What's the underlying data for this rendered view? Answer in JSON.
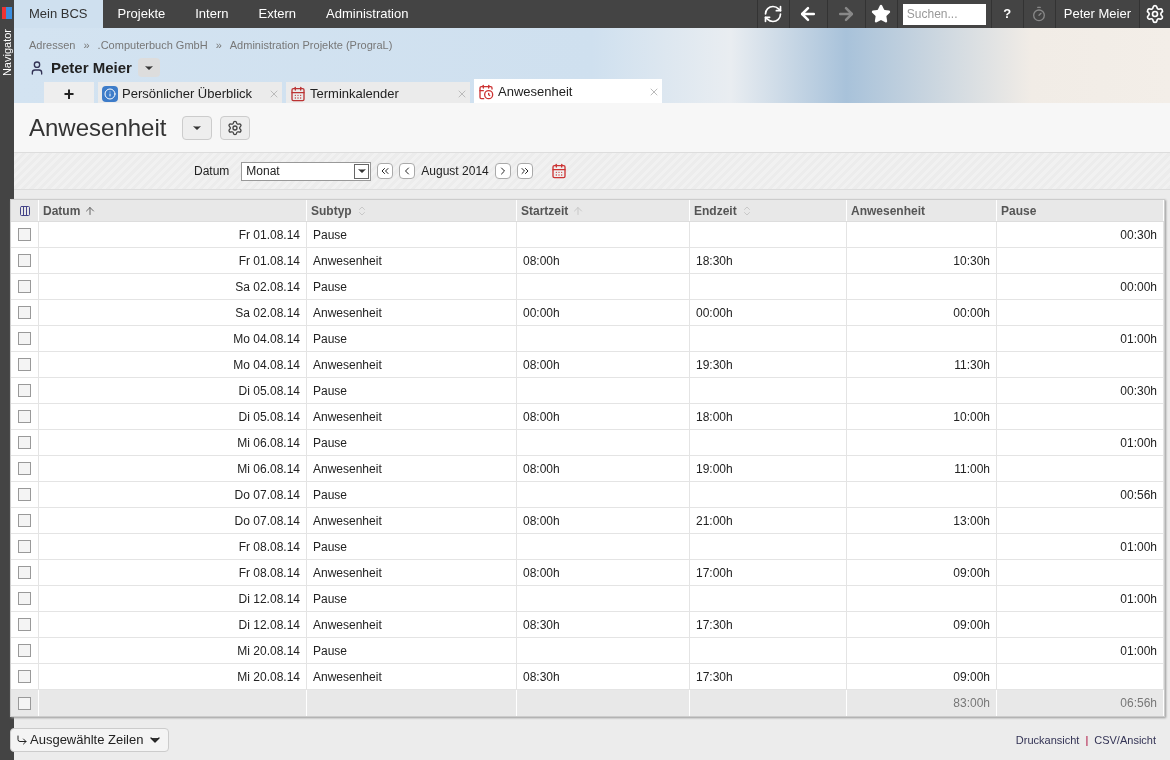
{
  "navigator": {
    "label": "Navigator"
  },
  "top_menu": [
    {
      "label": "Mein BCS",
      "selected": true
    },
    {
      "label": "Projekte",
      "selected": false
    },
    {
      "label": "Intern",
      "selected": false
    },
    {
      "label": "Extern",
      "selected": false
    },
    {
      "label": "Administration",
      "selected": false
    }
  ],
  "toolbar": {
    "search": {
      "placeholder": "Suchen..."
    },
    "help": "?",
    "user": "Peter Meier",
    "forward_disabled": true
  },
  "breadcrumb": [
    "Adressen",
    "»",
    ".Computerbuch GmbH",
    "»",
    "Administration Projekte (PrograL)"
  ],
  "person": "Peter Meier",
  "add_tab": "+",
  "tabs": [
    {
      "label": "Persönlicher Überblick",
      "kind": "info",
      "selected": false
    },
    {
      "label": "Terminkalender",
      "kind": "calendar",
      "selected": false
    },
    {
      "label": "Anwesenheit",
      "kind": "clock",
      "selected": true
    }
  ],
  "page_title": "Anwesenheit",
  "filter": {
    "label": "Datum",
    "value": "Monat",
    "period": "August 2014"
  },
  "table": {
    "columns": [
      {
        "label": "Datum",
        "kind": "sorted"
      },
      {
        "label": "Subtyp",
        "kind": "sortable"
      },
      {
        "label": "Startzeit",
        "kind": "presorted"
      },
      {
        "label": "Endzeit",
        "kind": "sortable"
      },
      {
        "label": "Anwesenheit",
        "kind": "plain"
      },
      {
        "label": "Pause",
        "kind": "plain"
      }
    ],
    "rows": [
      {
        "checked": false,
        "cells": [
          "Fr 01.08.14",
          "Pause",
          "",
          "",
          "",
          "00:30h"
        ]
      },
      {
        "checked": false,
        "cells": [
          "Fr 01.08.14",
          "Anwesenheit",
          "08:00h",
          "18:30h",
          "10:30h",
          ""
        ]
      },
      {
        "checked": false,
        "cells": [
          "Sa 02.08.14",
          "Pause",
          "",
          "",
          "",
          "00:00h"
        ]
      },
      {
        "checked": false,
        "cells": [
          "Sa 02.08.14",
          "Anwesenheit",
          "00:00h",
          "00:00h",
          "00:00h",
          ""
        ]
      },
      {
        "checked": false,
        "cells": [
          "Mo 04.08.14",
          "Pause",
          "",
          "",
          "",
          "01:00h"
        ]
      },
      {
        "checked": false,
        "cells": [
          "Mo 04.08.14",
          "Anwesenheit",
          "08:00h",
          "19:30h",
          "11:30h",
          ""
        ]
      },
      {
        "checked": false,
        "cells": [
          "Di 05.08.14",
          "Pause",
          "",
          "",
          "",
          "00:30h"
        ]
      },
      {
        "checked": false,
        "cells": [
          "Di 05.08.14",
          "Anwesenheit",
          "08:00h",
          "18:00h",
          "10:00h",
          ""
        ]
      },
      {
        "checked": false,
        "cells": [
          "Mi 06.08.14",
          "Pause",
          "",
          "",
          "",
          "01:00h"
        ]
      },
      {
        "checked": false,
        "cells": [
          "Mi 06.08.14",
          "Anwesenheit",
          "08:00h",
          "19:00h",
          "11:00h",
          ""
        ]
      },
      {
        "checked": false,
        "cells": [
          "Do 07.08.14",
          "Pause",
          "",
          "",
          "",
          "00:56h"
        ]
      },
      {
        "checked": false,
        "cells": [
          "Do 07.08.14",
          "Anwesenheit",
          "08:00h",
          "21:00h",
          "13:00h",
          ""
        ]
      },
      {
        "checked": false,
        "cells": [
          "Fr 08.08.14",
          "Pause",
          "",
          "",
          "",
          "01:00h"
        ]
      },
      {
        "checked": false,
        "cells": [
          "Fr 08.08.14",
          "Anwesenheit",
          "08:00h",
          "17:00h",
          "09:00h",
          ""
        ]
      },
      {
        "checked": false,
        "cells": [
          "Di 12.08.14",
          "Pause",
          "",
          "",
          "",
          "01:00h"
        ]
      },
      {
        "checked": false,
        "cells": [
          "Di 12.08.14",
          "Anwesenheit",
          "08:30h",
          "17:30h",
          "09:00h",
          ""
        ]
      },
      {
        "checked": false,
        "cells": [
          "Mi 20.08.14",
          "Pause",
          "",
          "",
          "",
          "01:00h"
        ]
      },
      {
        "checked": false,
        "cells": [
          "Mi 20.08.14",
          "Anwesenheit",
          "08:30h",
          "17:30h",
          "09:00h",
          ""
        ]
      }
    ],
    "footer": {
      "checked": false,
      "cells": [
        "",
        "",
        "",
        "",
        "83:00h",
        "06:56h"
      ]
    }
  },
  "actions_button": "Ausgewählte Zeilen",
  "links": [
    "Druckansicht",
    "|",
    "CSV/Ansicht"
  ]
}
